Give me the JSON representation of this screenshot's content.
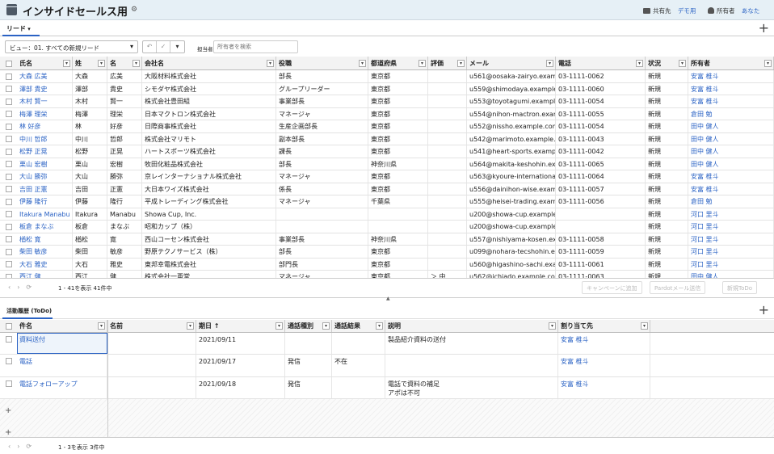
{
  "header": {
    "title": "インサイドセールス用",
    "shared_label": "共有先",
    "shared_value": "デモ用",
    "owner_label": "所有者",
    "owner_value": "あなた"
  },
  "tabs": {
    "main": "リード",
    "activity": "活動履歴 (ToDo)"
  },
  "toolbar": {
    "view_label": "ビュー：01. すべての新規リード",
    "owner_filter_label": "担当者",
    "owner_search_placeholder": "所有者を検索"
  },
  "leads": {
    "columns": [
      "氏名",
      "姓",
      "名",
      "会社名",
      "役職",
      "都道府県",
      "評価",
      "メール",
      "電話",
      "状況",
      "所有者"
    ],
    "rows": [
      [
        "大森 広美",
        "大森",
        "広美",
        "大阪材料株式会社",
        "部長",
        "東京都",
        "",
        "u561@oosaka-zairyo.examp...",
        "03-1111-0062",
        "新規",
        "安富 椎斗"
      ],
      [
        "澤部 貴史",
        "澤部",
        "貴史",
        "シモダヤ株式会社",
        "グループリーダー",
        "東京都",
        "",
        "u559@shimodaya.example....",
        "03-1111-0060",
        "新規",
        "安富 椎斗"
      ],
      [
        "木村 賢一",
        "木村",
        "賢一",
        "株式会社豊田組",
        "事業部長",
        "東京都",
        "",
        "u553@toyotagumi.example....",
        "03-1111-0054",
        "新規",
        "安富 椎斗"
      ],
      [
        "梅澤 理栄",
        "梅澤",
        "理栄",
        "日本マクトロン株式会社",
        "マネージャ",
        "東京都",
        "",
        "u554@nihon-mactron.exam...",
        "03-1111-0055",
        "新規",
        "倉田 勉"
      ],
      [
        "林 好彦",
        "林",
        "好彦",
        "日際商事株式会社",
        "生産企画部長",
        "東京都",
        "",
        "u552@nissho.example.com",
        "03-1111-0054",
        "新規",
        "田中 健人"
      ],
      [
        "中川 哲郎",
        "中川",
        "哲郎",
        "株式会社マリモト",
        "副本部長",
        "東京都",
        "",
        "u542@marimoto.example.c...",
        "03-1111-0043",
        "新規",
        "田中 健人"
      ],
      [
        "松野 正晃",
        "松野",
        "正晃",
        "ハートスポーツ株式会社",
        "課長",
        "東京都",
        "",
        "u541@heart-sports.example...",
        "03-1111-0042",
        "新規",
        "田中 健人"
      ],
      [
        "栗山 宏樹",
        "栗山",
        "宏樹",
        "牧田化粧品株式会社",
        "部長",
        "神奈川県",
        "",
        "u564@makita-keshohin.exa...",
        "03-1111-0065",
        "新規",
        "田中 健人"
      ],
      [
        "大山 勝弥",
        "大山",
        "勝弥",
        "京レインターナショナル株式会社",
        "マネージャ",
        "東京都",
        "",
        "u563@kyoure-international....",
        "03-1111-0064",
        "新規",
        "安富 椎斗"
      ],
      [
        "吉田 正憲",
        "吉田",
        "正憲",
        "大日本ワイズ株式会社",
        "係長",
        "東京都",
        "",
        "u556@dainihon-wise.examp...",
        "03-1111-0057",
        "新規",
        "安富 椎斗"
      ],
      [
        "伊藤 隆行",
        "伊藤",
        "隆行",
        "平成トレーディング株式会社",
        "マネージャ",
        "千葉県",
        "",
        "u555@heisei-trading.examp...",
        "03-1111-0056",
        "新規",
        "倉田 勉"
      ],
      [
        "Itakura Manabu",
        "Itakura",
        "Manabu",
        "Showa Cup, Inc.",
        "",
        "",
        "",
        "u200@showa-cup.example....",
        "",
        "新規",
        "河口 里斗"
      ],
      [
        "板倉 まなぶ",
        "板倉",
        "まなぶ",
        "昭和カップ（株）",
        "",
        "",
        "",
        "u200@showa-cup.example....",
        "",
        "新規",
        "河口 里斗"
      ],
      [
        "楢松 寛",
        "楢松",
        "寛",
        "西山コーセン株式会社",
        "事業部長",
        "神奈川県",
        "",
        "u557@nishiyama-kosen.exa...",
        "03-1111-0058",
        "新規",
        "河口 里斗"
      ],
      [
        "柴田 敏彦",
        "柴田",
        "敏彦",
        "野原テクノサービス（株）",
        "部長",
        "東京都",
        "",
        "u099@nohara-tecshohin.exa...",
        "03-1111-0059",
        "新規",
        "河口 里斗"
      ],
      [
        "大石 雅史",
        "大石",
        "雅史",
        "東邦幸電株式会社",
        "部門長",
        "東京都",
        "",
        "u560@higashino-sachi.exa...",
        "03-1111-0061",
        "新規",
        "河口 里斗"
      ],
      [
        "西江 健",
        "西江",
        "健",
        "株式会社一亜堂",
        "マネージャ",
        "東京都",
        "＞ 中",
        "u562@ichiado.example.co...",
        "03-1111-0063",
        "新規",
        "田中 健人"
      ]
    ]
  },
  "leads_pager": {
    "text": "1 - 41を表示 41件中",
    "btn_campaign": "キャンペーンに追加",
    "btn_pardot": "Pardotメール送信",
    "btn_todo": "新規ToDo"
  },
  "activity": {
    "columns": [
      "件名",
      "名前",
      "期日 ↑",
      "通話種別",
      "通話結果",
      "説明",
      "割り当て先"
    ],
    "rows": [
      [
        "資料送付",
        "",
        "2021/09/11",
        "",
        "",
        "製品紹介資料の送付",
        "安富 椎斗"
      ],
      [
        "電話",
        "",
        "2021/09/17",
        "発信",
        "不在",
        "",
        "安富 椎斗"
      ],
      [
        "電話フォローアップ",
        "",
        "2021/09/18",
        "発信",
        "",
        "電話で資料の補足\nアポは不可",
        "安富 椎斗"
      ]
    ]
  },
  "activity_pager": {
    "text": "1 - 3を表示 3件中"
  }
}
